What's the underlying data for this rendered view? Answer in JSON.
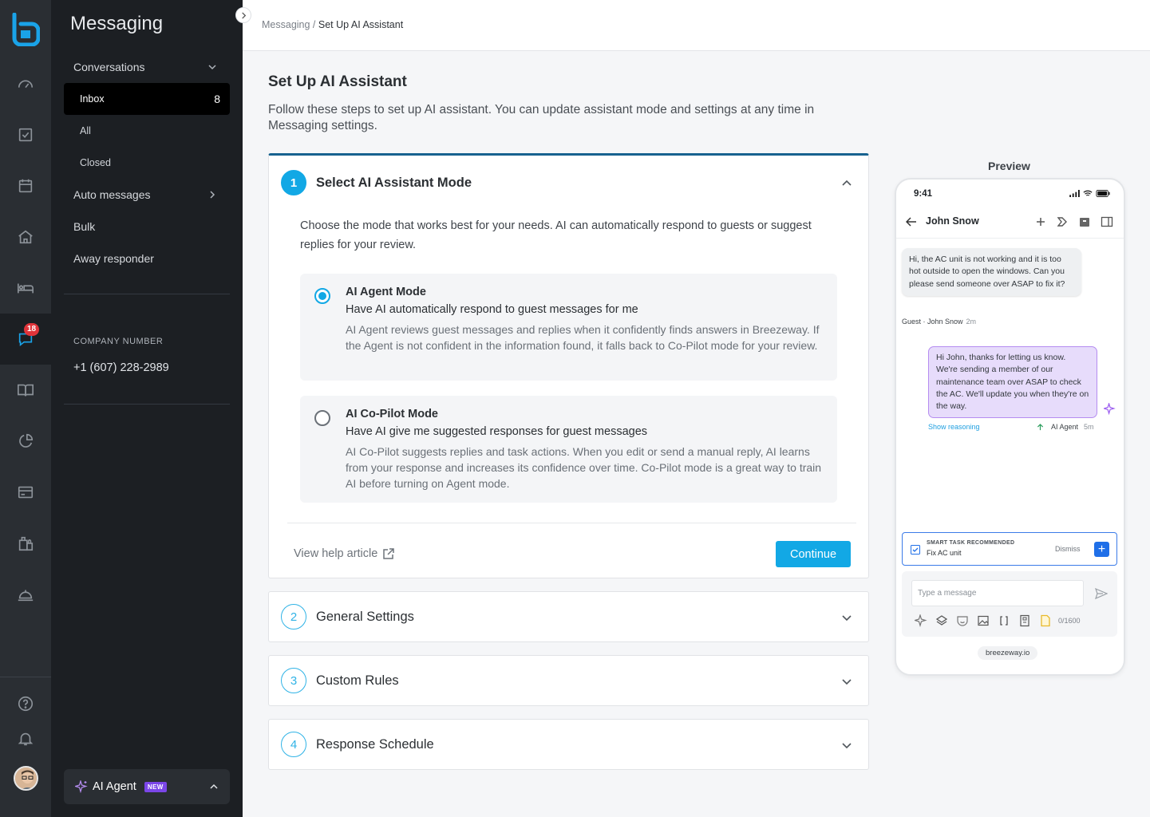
{
  "rail": {
    "messages_badge": "18"
  },
  "nav": {
    "title": "Messaging",
    "items": [
      {
        "label": "Conversations"
      },
      {
        "label": "Inbox",
        "count": "8"
      },
      {
        "label": "All"
      },
      {
        "label": "Closed"
      },
      {
        "label": "Auto messages"
      },
      {
        "label": "Bulk"
      },
      {
        "label": "Away responder"
      }
    ],
    "company_label": "COMPANY NUMBER",
    "company_phone": "+1 (607) 228-2989",
    "ai_agent_label": "AI Agent",
    "ai_agent_badge": "NEW"
  },
  "breadcrumb": {
    "parent": "Messaging",
    "separator": " / ",
    "current": "Set Up AI Assistant"
  },
  "page": {
    "title": "Set Up AI Assistant",
    "subtitle": "Follow these steps to set up AI assistant. You can update assistant mode and settings at any time in Messaging settings."
  },
  "steps": [
    {
      "num": "1",
      "title": "Select AI Assistant Mode"
    },
    {
      "num": "2",
      "title": "General Settings"
    },
    {
      "num": "3",
      "title": "Custom Rules"
    },
    {
      "num": "4",
      "title": "Response Schedule"
    }
  ],
  "step1": {
    "description": "Choose the mode that works best for your needs. AI can automatically respond to guests or suggest replies for your review.",
    "options": [
      {
        "title": "AI Agent Mode",
        "subtitle": "Have AI automatically respond to guest messages for me",
        "text": "AI Agent reviews guest messages and replies when it confidently finds answers in Breezeway. If the Agent is not confident in the information found, it falls back to Co-Pilot mode for your review.",
        "selected": true
      },
      {
        "title": "AI Co-Pilot Mode",
        "subtitle": "Have AI give me suggested responses for guest messages",
        "text": "AI Co-Pilot suggests replies and task actions. When you edit or send a manual reply, AI learns from your response and increases its confidence over time. Co-Pilot mode is a great way to train AI before turning on Agent mode.",
        "selected": false
      }
    ],
    "help_link": "View help article",
    "continue_label": "Continue"
  },
  "preview": {
    "label": "Preview",
    "time": "9:41",
    "contact": "John Snow",
    "guest_message": "Hi, the AC unit is not working and it is too hot outside to open the windows. Can you please send someone over ASAP to fix it?",
    "guest_meta": "Guest · John Snow",
    "guest_time": "2m",
    "agent_message": "Hi John, thanks for letting us know. We're sending a member of our maintenance team over ASAP to check the AC. We'll update you when they're on the way.",
    "show_reasoning": "Show reasoning",
    "agent_meta": "AI Agent",
    "agent_time": "5m",
    "smart_label": "SMART TASK RECOMMENDED",
    "smart_task": "Fix AC unit",
    "dismiss": "Dismiss",
    "input_placeholder": "Type a message",
    "char_count": "0/1600",
    "url": "breezeway.io"
  },
  "colors": {
    "accent": "#12a8e5",
    "rail_bg": "#2a2e33",
    "nav_bg": "#1c1f23",
    "ai_purple": "#7b46e8",
    "badge_red": "#e0343a"
  }
}
